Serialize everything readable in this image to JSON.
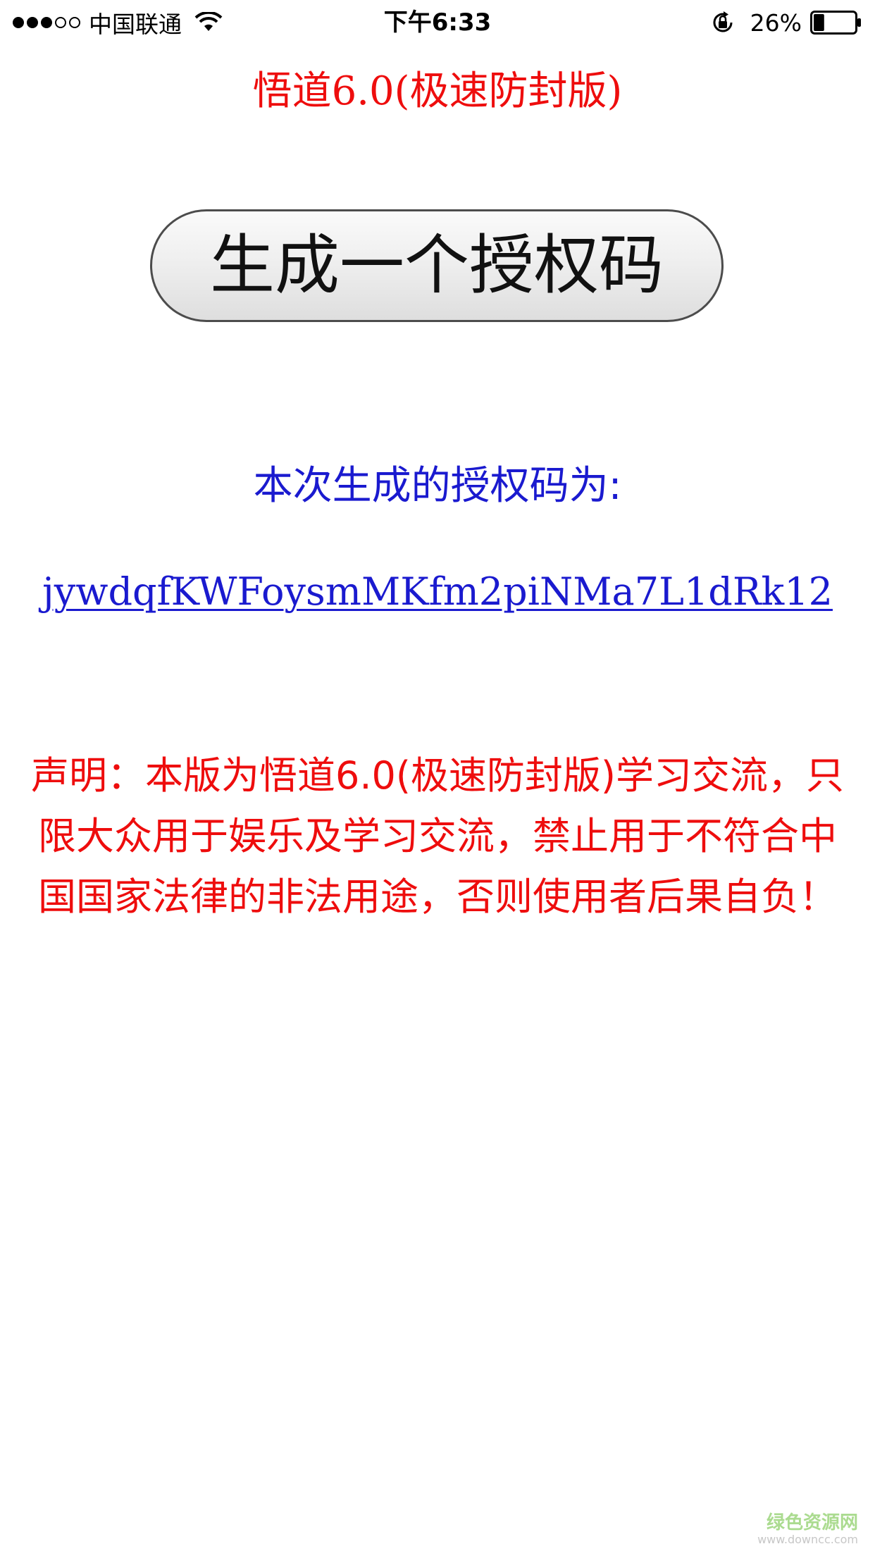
{
  "status_bar": {
    "signal_bars_filled": 3,
    "signal_bars_total": 5,
    "carrier": "中国联通",
    "wifi_icon": "wifi-icon",
    "time": "下午6:33",
    "rotation_lock_icon": "rotation-lock-icon",
    "battery_percent": "26%",
    "battery_level": 0.26
  },
  "page": {
    "title": "悟道6.0(极速防封版)",
    "generate_button_label": "生成一个授权码",
    "code_label": "本次生成的授权码为:",
    "code_value": "jywdqfKWFoysmMKfm2piNMa7L1dRk12",
    "disclaimer": "声明：本版为悟道6.0(极速防封版)学习交流，只限大众用于娱乐及学习交流，禁止用于不符合中国国家法律的非法用途，否则使用者后果自负！"
  },
  "watermark": {
    "name": "绿色资源网",
    "url": "www.downcc.com"
  },
  "colors": {
    "title_red": "#ee0d0d",
    "link_blue": "#1a1acf",
    "button_border": "#4c4c4c"
  }
}
